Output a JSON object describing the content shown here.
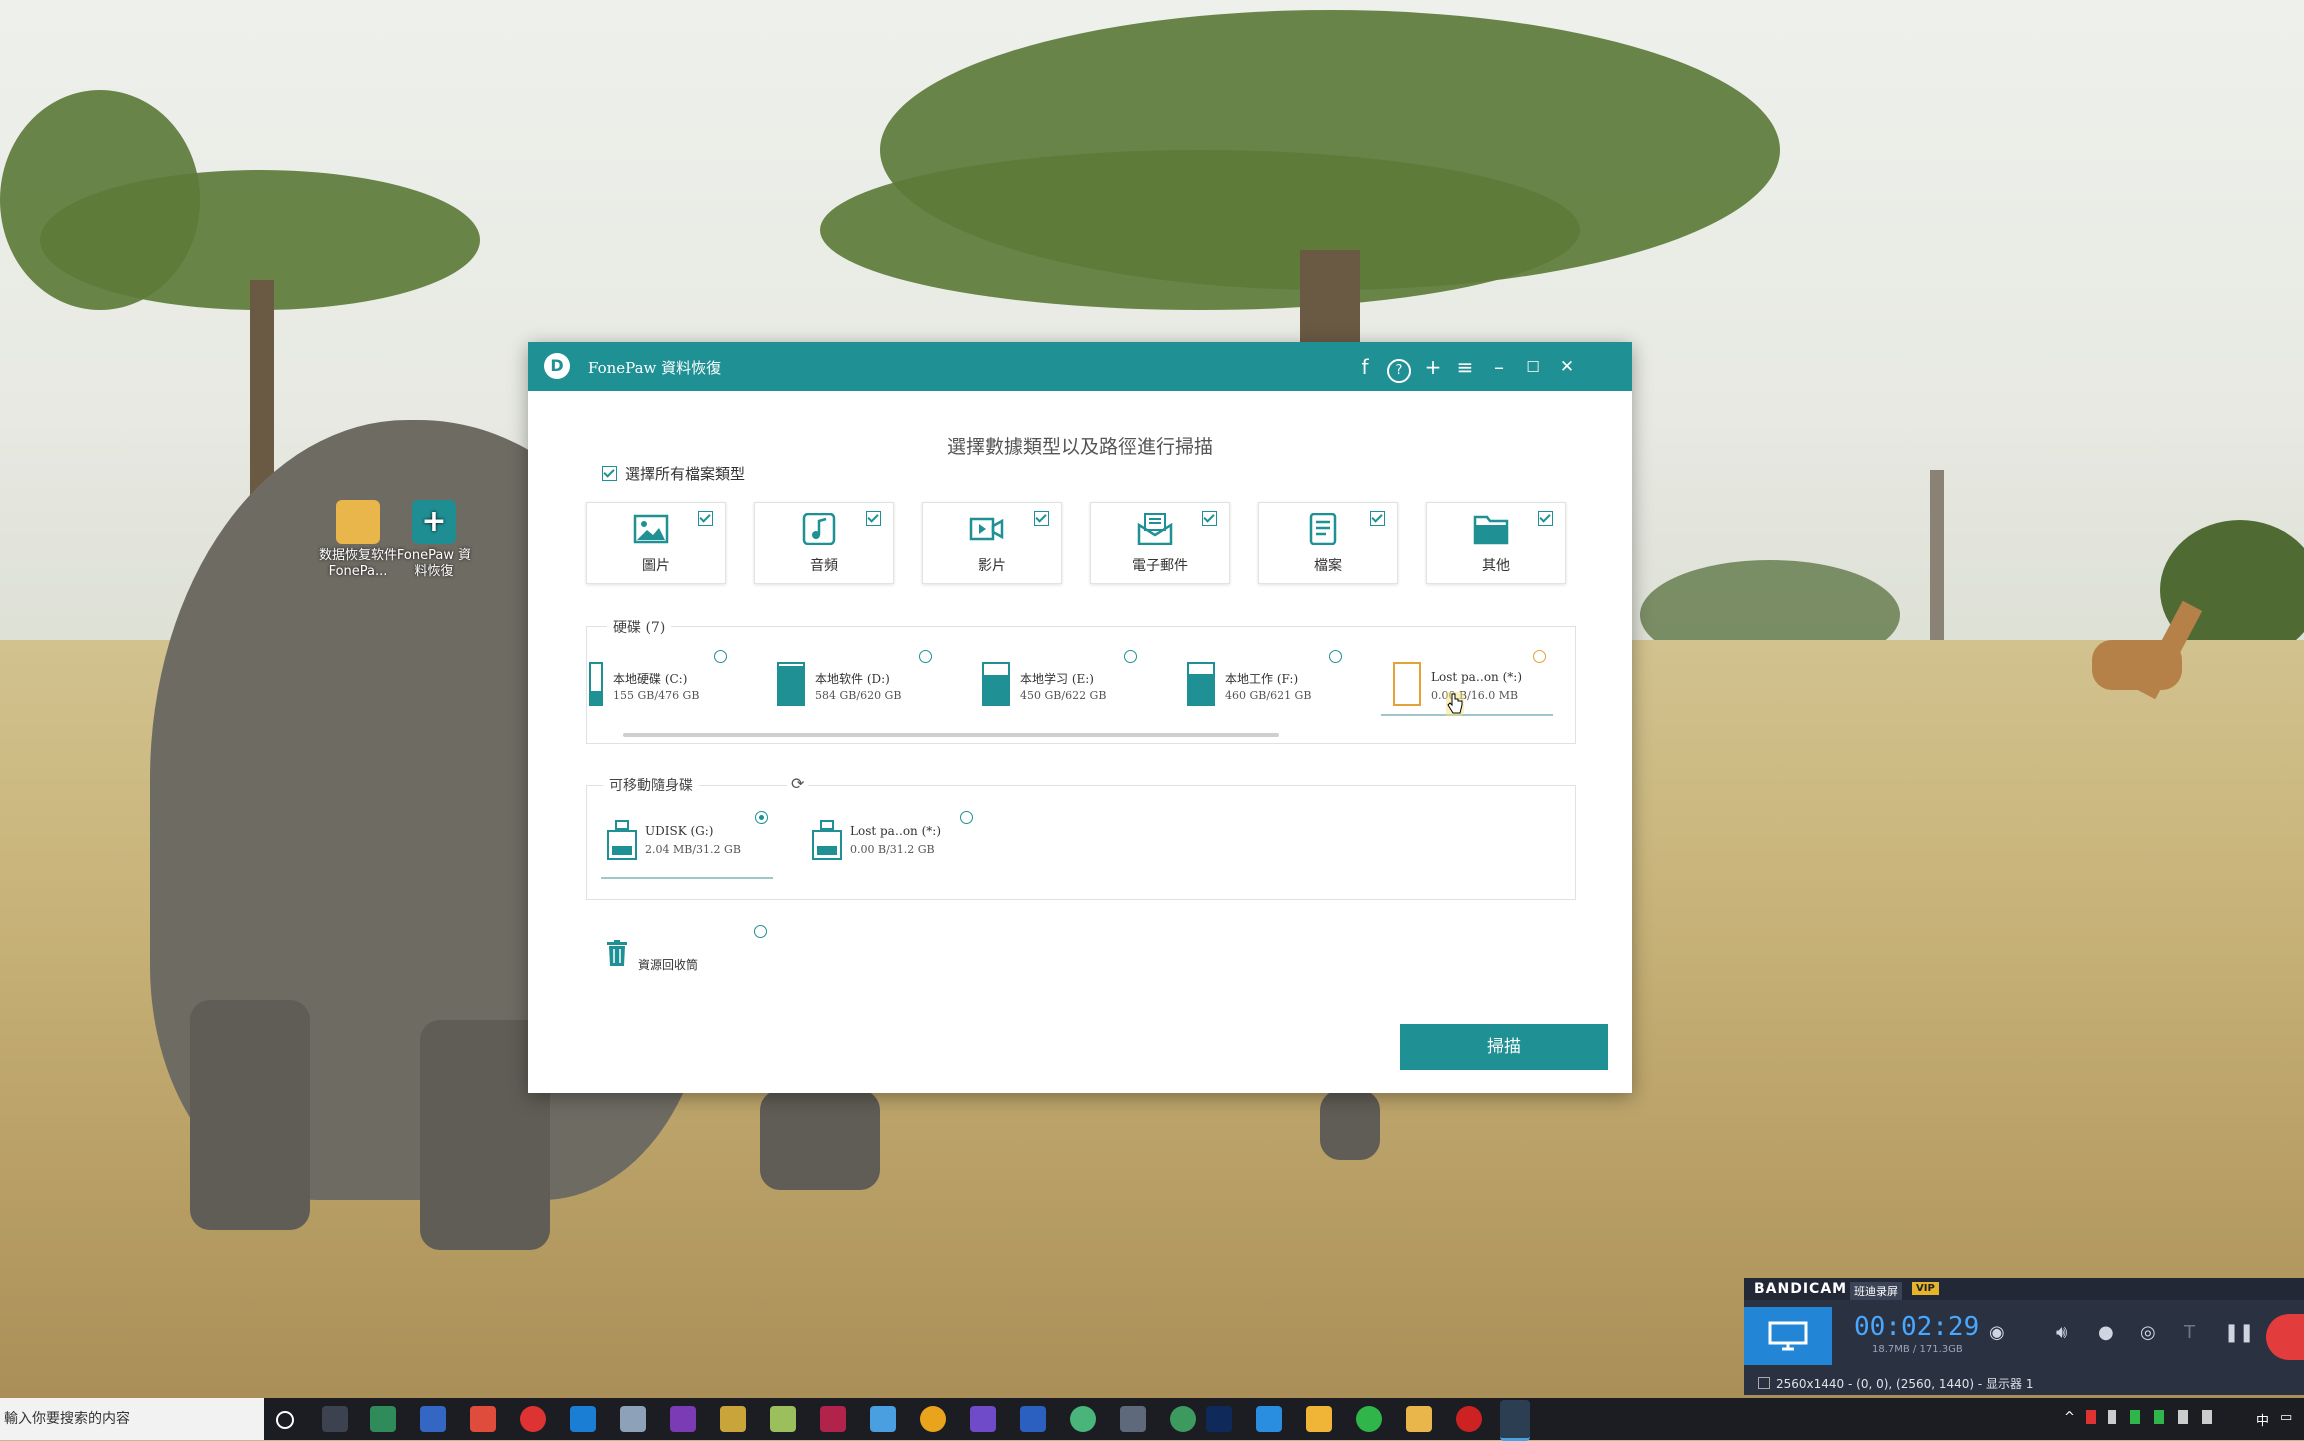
{
  "desktop": {
    "icons": [
      {
        "label": "数据恢复软件 FonePa..."
      },
      {
        "label": "FonePaw 資料恢復"
      }
    ]
  },
  "window": {
    "title": "FonePaw 資料恢復",
    "controls": {
      "facebook": "f",
      "feedback": "?",
      "add": "+",
      "menu": "≡",
      "minimize": "–",
      "maximize": "☐",
      "close": "✕"
    }
  },
  "headline": "選擇數據類型以及路徑進行掃描",
  "select_all": {
    "label": "選擇所有檔案類型",
    "checked": true
  },
  "file_types": [
    {
      "label": "圖片",
      "icon": "image-icon",
      "checked": true
    },
    {
      "label": "音頻",
      "icon": "music-icon",
      "checked": true
    },
    {
      "label": "影片",
      "icon": "video-icon",
      "checked": true
    },
    {
      "label": "電子郵件",
      "icon": "email-icon",
      "checked": true
    },
    {
      "label": "檔案",
      "icon": "document-icon",
      "checked": true
    },
    {
      "label": "其他",
      "icon": "folder-icon",
      "checked": true
    }
  ],
  "hard_drives": {
    "title": "硬碟 (7)",
    "items": [
      {
        "name": "本地硬碟 (C:)",
        "size": "155 GB/476 GB",
        "used": 0.33,
        "selected": false
      },
      {
        "name": "本地软件 (D:)",
        "size": "584 GB/620 GB",
        "used": 0.94,
        "selected": false
      },
      {
        "name": "本地学习 (E:)",
        "size": "450 GB/622 GB",
        "used": 0.72,
        "selected": false
      },
      {
        "name": "本地工作 (F:)",
        "size": "460 GB/621 GB",
        "used": 0.74,
        "selected": false
      },
      {
        "name": "Lost pa‥on (*:)",
        "size": "0.00 B/16.0 MB",
        "used": 0.0,
        "selected": false
      }
    ]
  },
  "removable": {
    "title": "可移動隨身碟",
    "items": [
      {
        "name": "UDISK (G:)",
        "size": "2.04 MB/31.2 GB",
        "selected": true
      },
      {
        "name": "Lost pa‥on (*:)",
        "size": "0.00  B/31.2 GB",
        "selected": false
      }
    ]
  },
  "recycle_bin": {
    "label": "資源回收筒",
    "selected": false
  },
  "scan_button": "掃描",
  "bandicam": {
    "brand": "BANDICAM",
    "subtitle": "班迪录屏",
    "vip": "VIP",
    "time": "00:02:29",
    "size": "18.7MB / 171.3GB",
    "status": "2560x1440 - (0, 0), (2560, 1440) - 显示器 1"
  },
  "taskbar": {
    "search_placeholder": "輸入你要搜索的内容",
    "ime": "中"
  },
  "colors": {
    "accent": "#1f9094",
    "warning": "#e3a239",
    "bandicam_bg": "#2a3140"
  }
}
